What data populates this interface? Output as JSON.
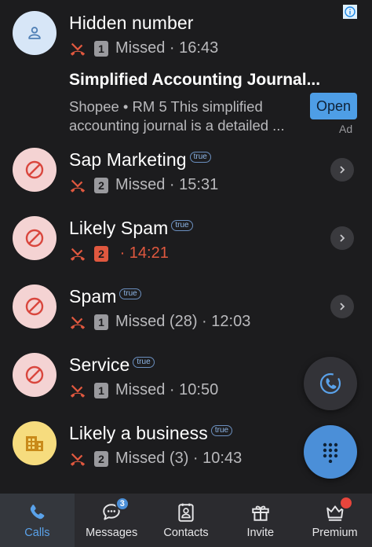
{
  "colors": {
    "background": "#1c1c1e",
    "missed_red": "#e0583f",
    "accent_blue": "#4b8fd8",
    "nav_bg": "#2b2b2f"
  },
  "calls": [
    {
      "name": "Hidden number",
      "tag": "",
      "sim": "1",
      "status": "Missed",
      "time": "· 16:43",
      "avatar": "person-icon",
      "has_chevron": false
    },
    {
      "name": "Sap Marketing",
      "tag": "true",
      "sim": "2",
      "status": "Missed",
      "time": "· 15:31",
      "avatar": "blocked-icon",
      "has_chevron": true
    },
    {
      "name": "Likely Spam",
      "tag": "true",
      "sim": "2",
      "status": "",
      "time": "· 14:21",
      "avatar": "blocked-icon",
      "has_chevron": true
    },
    {
      "name": "Spam",
      "tag": "true",
      "sim": "1",
      "status": "Missed (28)",
      "time": "· 12:03",
      "avatar": "blocked-icon",
      "has_chevron": true
    },
    {
      "name": "Service",
      "tag": "true",
      "sim": "1",
      "status": "Missed",
      "time": "· 10:50",
      "avatar": "blocked-icon",
      "has_chevron": false
    },
    {
      "name": "Likely a business",
      "tag": "true",
      "sim": "2",
      "status": "Missed (3)",
      "time": "· 10:43",
      "avatar": "business-icon",
      "has_chevron": false
    }
  ],
  "ad": {
    "title": "Simplified Accounting Journal...",
    "line1": "Shopee • RM 5 This simplified",
    "line2": "accounting journal is a detailed ...",
    "open_label": "Open",
    "ad_label": "Ad",
    "info_icon": "info-icon"
  },
  "nav": {
    "items": [
      {
        "label": "Calls",
        "icon": "phone-icon"
      },
      {
        "label": "Messages",
        "icon": "chat-icon",
        "badge": "3"
      },
      {
        "label": "Contacts",
        "icon": "contact-card-icon"
      },
      {
        "label": "Invite",
        "icon": "gift-icon"
      },
      {
        "label": "Premium",
        "icon": "crown-icon"
      }
    ]
  }
}
